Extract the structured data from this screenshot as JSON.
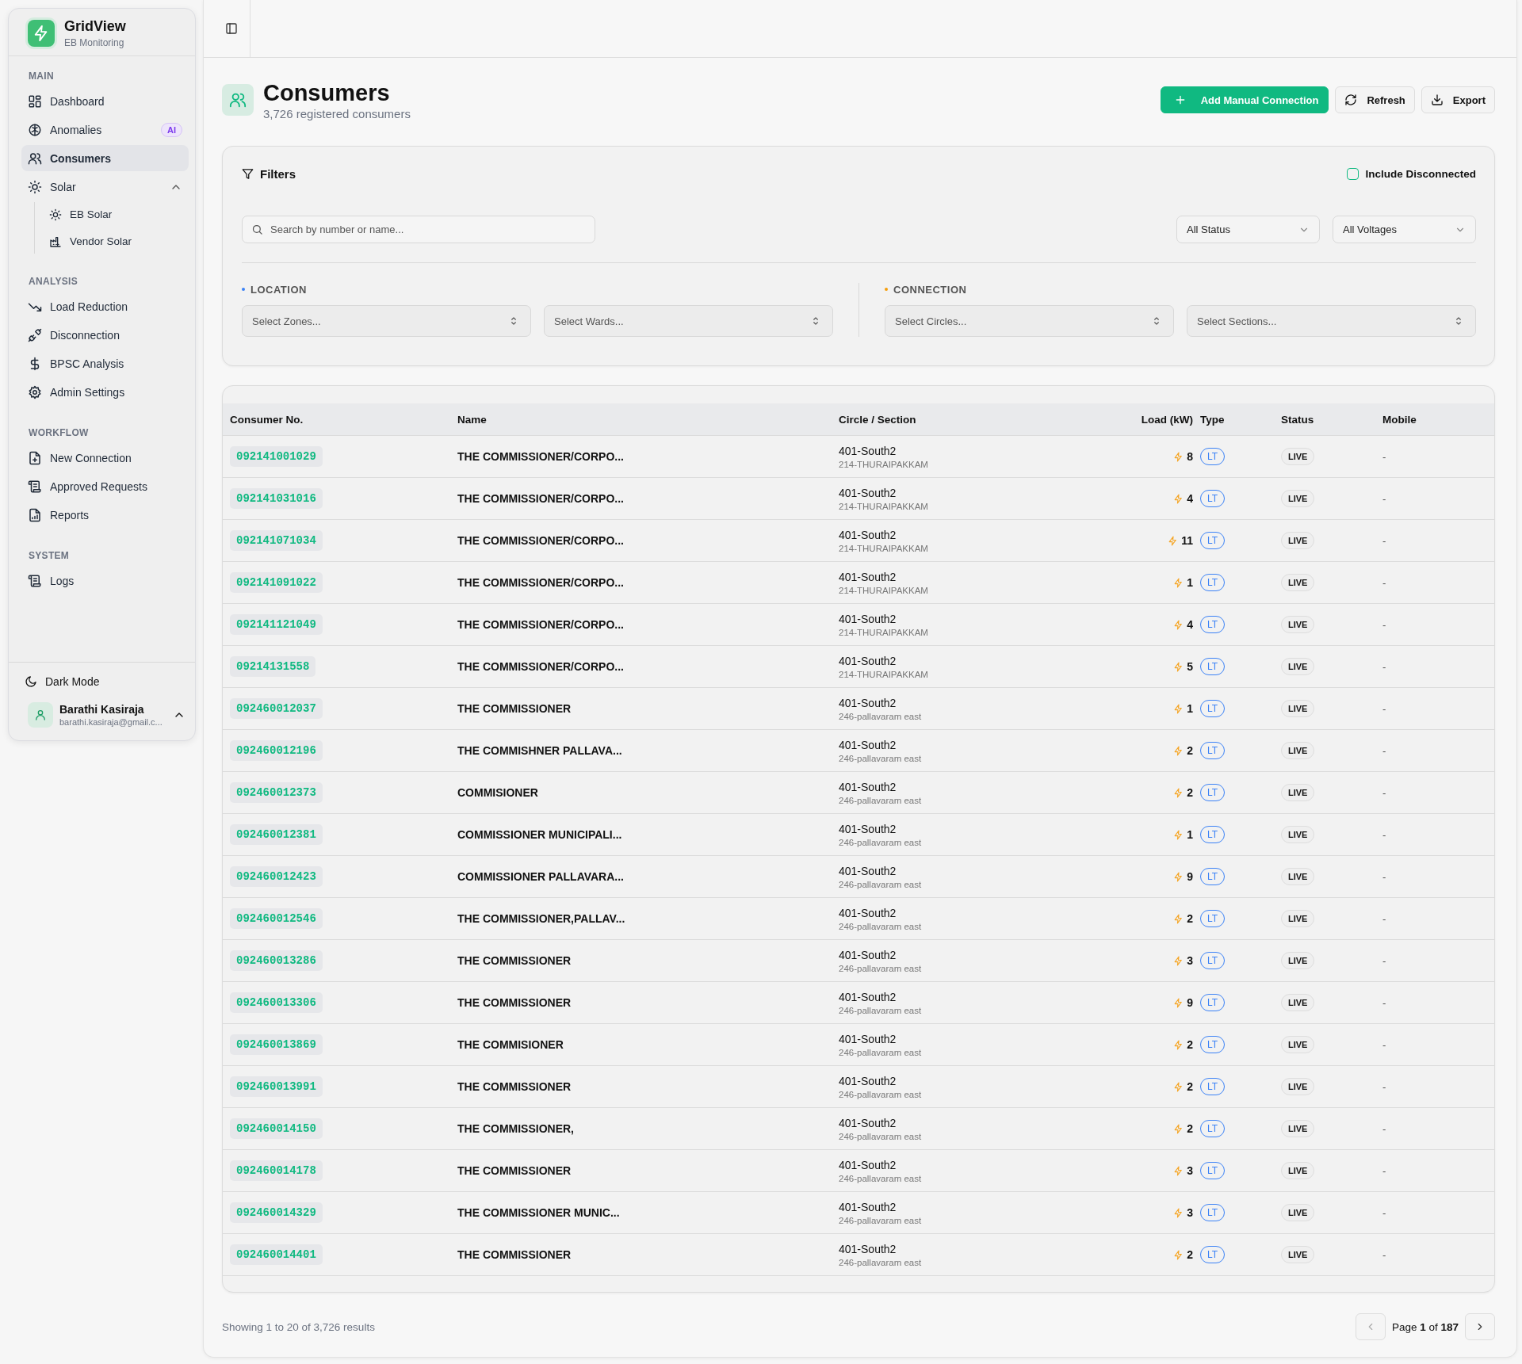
{
  "sidebar": {
    "brand": {
      "name": "GridView",
      "tagline": "EB Monitoring"
    },
    "sections": [
      {
        "title": "MAIN",
        "items": [
          {
            "label": "Dashboard",
            "selected": false
          },
          {
            "label": "Anomalies",
            "selected": false,
            "badge": "AI"
          },
          {
            "label": "Consumers",
            "selected": true
          },
          {
            "label": "Solar",
            "selected": false,
            "expanded": true,
            "children": [
              {
                "label": "EB Solar",
                "selected": false
              },
              {
                "label": "Vendor Solar",
                "selected": false
              }
            ]
          }
        ]
      },
      {
        "title": "ANALYSIS",
        "items": [
          {
            "label": "Load Reduction",
            "selected": false
          },
          {
            "label": "Disconnection",
            "selected": false
          },
          {
            "label": "BPSC Analysis",
            "selected": false
          },
          {
            "label": "Admin Settings",
            "selected": false
          }
        ]
      },
      {
        "title": "WORKFLOW",
        "items": [
          {
            "label": "New Connection",
            "selected": false
          },
          {
            "label": "Approved Requests",
            "selected": false
          },
          {
            "label": "Reports",
            "selected": false
          }
        ]
      },
      {
        "title": "SYSTEM",
        "items": [
          {
            "label": "Logs",
            "selected": false
          }
        ]
      }
    ],
    "dark_mode": {
      "label": "Dark Mode"
    },
    "user": {
      "name": "Barathi Kasiraja",
      "email": "barathi.kasiraja@gmail.c..."
    }
  },
  "header": {
    "title": "Consumers",
    "subtitle": "3,726 registered consumers",
    "buttons": [
      {
        "label": "Add Manual Connection",
        "kind": "primary"
      },
      {
        "label": "Refresh",
        "kind": "refresh"
      },
      {
        "label": "Export",
        "kind": "export"
      }
    ]
  },
  "filters": {
    "title": "Filters",
    "include_disconnected": {
      "label": "Include Disconnected",
      "checked": false
    },
    "search": {
      "placeholder": "Search by number or name..."
    },
    "dropdowns": [
      "All Status",
      "All Voltages"
    ],
    "groups": [
      {
        "title": "LOCATION",
        "color": "#3b82f6",
        "selects": [
          "Select Zones...",
          "Select Wards..."
        ]
      },
      {
        "title": "CONNECTION",
        "color": "#f59e0b",
        "selects": [
          "Select Circles...",
          "Select Sections..."
        ]
      }
    ]
  },
  "table": {
    "columns": [
      "Consumer No.",
      "Name",
      "Circle / Section",
      "Load (kW)",
      "Type",
      "Status",
      "Mobile"
    ],
    "rows": [
      {
        "number": "092141001029",
        "name": "THE COMMISSIONER/CORPO...",
        "circle": "401-South2",
        "section": "214-THURAIPAKKAM",
        "load": "8",
        "type": "LT",
        "status": "LIVE",
        "mobile": "-"
      },
      {
        "number": "092141031016",
        "name": "THE COMMISSIONER/CORPO...",
        "circle": "401-South2",
        "section": "214-THURAIPAKKAM",
        "load": "4",
        "type": "LT",
        "status": "LIVE",
        "mobile": "-"
      },
      {
        "number": "092141071034",
        "name": "THE COMMISSIONER/CORPO...",
        "circle": "401-South2",
        "section": "214-THURAIPAKKAM",
        "load": "11",
        "type": "LT",
        "status": "LIVE",
        "mobile": "-"
      },
      {
        "number": "092141091022",
        "name": "THE COMMISSIONER/CORPO...",
        "circle": "401-South2",
        "section": "214-THURAIPAKKAM",
        "load": "1",
        "type": "LT",
        "status": "LIVE",
        "mobile": "-"
      },
      {
        "number": "092141121049",
        "name": "THE COMMISSIONER/CORPO...",
        "circle": "401-South2",
        "section": "214-THURAIPAKKAM",
        "load": "4",
        "type": "LT",
        "status": "LIVE",
        "mobile": "-"
      },
      {
        "number": "09214131558",
        "name": "THE COMMISSIONER/CORPO...",
        "circle": "401-South2",
        "section": "214-THURAIPAKKAM",
        "load": "5",
        "type": "LT",
        "status": "LIVE",
        "mobile": "-"
      },
      {
        "number": "092460012037",
        "name": "THE COMMISSIONER",
        "circle": "401-South2",
        "section": "246-pallavaram east",
        "load": "1",
        "type": "LT",
        "status": "LIVE",
        "mobile": "-"
      },
      {
        "number": "092460012196",
        "name": "THE COMMISHNER PALLAVA...",
        "circle": "401-South2",
        "section": "246-pallavaram east",
        "load": "2",
        "type": "LT",
        "status": "LIVE",
        "mobile": "-"
      },
      {
        "number": "092460012373",
        "name": "COMMISIONER",
        "circle": "401-South2",
        "section": "246-pallavaram east",
        "load": "2",
        "type": "LT",
        "status": "LIVE",
        "mobile": "-"
      },
      {
        "number": "092460012381",
        "name": "COMMISSIONER MUNICIPALI...",
        "circle": "401-South2",
        "section": "246-pallavaram east",
        "load": "1",
        "type": "LT",
        "status": "LIVE",
        "mobile": "-"
      },
      {
        "number": "092460012423",
        "name": "COMMISSIONER PALLAVARA...",
        "circle": "401-South2",
        "section": "246-pallavaram east",
        "load": "9",
        "type": "LT",
        "status": "LIVE",
        "mobile": "-"
      },
      {
        "number": "092460012546",
        "name": "THE COMMISSIONER,PALLAV...",
        "circle": "401-South2",
        "section": "246-pallavaram east",
        "load": "2",
        "type": "LT",
        "status": "LIVE",
        "mobile": "-"
      },
      {
        "number": "092460013286",
        "name": "THE COMMISSIONER",
        "circle": "401-South2",
        "section": "246-pallavaram east",
        "load": "3",
        "type": "LT",
        "status": "LIVE",
        "mobile": "-"
      },
      {
        "number": "092460013306",
        "name": "THE COMMISSIONER",
        "circle": "401-South2",
        "section": "246-pallavaram east",
        "load": "9",
        "type": "LT",
        "status": "LIVE",
        "mobile": "-"
      },
      {
        "number": "092460013869",
        "name": "THE COMMISIONER",
        "circle": "401-South2",
        "section": "246-pallavaram east",
        "load": "2",
        "type": "LT",
        "status": "LIVE",
        "mobile": "-"
      },
      {
        "number": "092460013991",
        "name": "THE COMMISSIONER",
        "circle": "401-South2",
        "section": "246-pallavaram east",
        "load": "2",
        "type": "LT",
        "status": "LIVE",
        "mobile": "-"
      },
      {
        "number": "092460014150",
        "name": "THE COMMISSIONER,",
        "circle": "401-South2",
        "section": "246-pallavaram east",
        "load": "2",
        "type": "LT",
        "status": "LIVE",
        "mobile": "-"
      },
      {
        "number": "092460014178",
        "name": "THE COMMISSIONER",
        "circle": "401-South2",
        "section": "246-pallavaram east",
        "load": "3",
        "type": "LT",
        "status": "LIVE",
        "mobile": "-"
      },
      {
        "number": "092460014329",
        "name": "THE COMMISSIONER MUNIC...",
        "circle": "401-South2",
        "section": "246-pallavaram east",
        "load": "3",
        "type": "LT",
        "status": "LIVE",
        "mobile": "-"
      },
      {
        "number": "092460014401",
        "name": "THE COMMISSIONER",
        "circle": "401-South2",
        "section": "246-pallavaram east",
        "load": "2",
        "type": "LT",
        "status": "LIVE",
        "mobile": "-"
      }
    ]
  },
  "footer": {
    "summary": "Showing 1 to 20 of 3,726 results",
    "page_label": "Page **1** of **187**"
  }
}
